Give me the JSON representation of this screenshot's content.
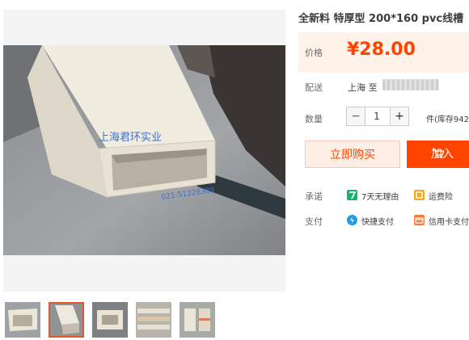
{
  "product": {
    "title": "全新料 特厚型 200*160 pvc线槽",
    "watermark_text": "上海君环实业",
    "watermark_phone": "021-51228389"
  },
  "price": {
    "label": "价格",
    "value": "¥28.00"
  },
  "shipping": {
    "label": "配送",
    "text": "上海 至"
  },
  "quantity": {
    "label": "数量",
    "minus": "−",
    "value": "1",
    "plus": "+",
    "stock_text": "件(库存942"
  },
  "actions": {
    "buy_now": "立即购买",
    "add_to_cart": "加入"
  },
  "services": {
    "promise_label": "承诺",
    "promise_items": [
      {
        "icon": "seven-day-return-icon",
        "text": "7天无理由",
        "color": "#12b56b"
      },
      {
        "icon": "shipping-insurance-icon",
        "text": "运费险",
        "color": "#f5a623"
      }
    ],
    "payment_label": "支付",
    "payment_items": [
      {
        "icon": "quick-pay-icon",
        "text": "快捷支付",
        "color": "#1e9be8"
      },
      {
        "icon": "credit-card-icon",
        "text": "信用卡支付",
        "color": "#f27c3c"
      }
    ]
  },
  "colors": {
    "accent": "#ff4400",
    "price_bg": "#fff2e8"
  }
}
